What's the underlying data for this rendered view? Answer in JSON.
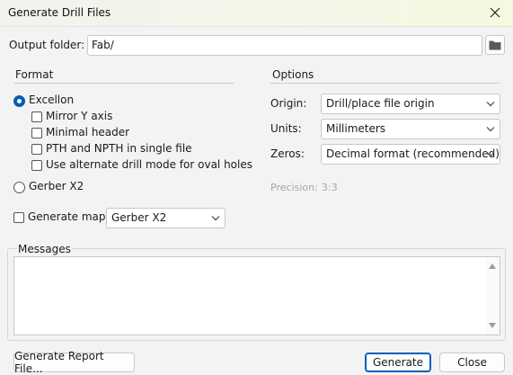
{
  "window": {
    "title": "Generate Drill Files"
  },
  "output": {
    "label": "Output folder:",
    "value": "Fab/"
  },
  "format": {
    "heading": "Format",
    "excellon_label": "Excellon",
    "excellon_selected": true,
    "options": [
      {
        "label": "Mirror Y axis",
        "checked": false
      },
      {
        "label": "Minimal header",
        "checked": false
      },
      {
        "label": "PTH and NPTH in single file",
        "checked": false
      },
      {
        "label": "Use alternate drill mode for oval holes",
        "checked": false
      }
    ],
    "gerber_label": "Gerber X2",
    "gerber_selected": false
  },
  "map": {
    "label": "Generate map:",
    "checked": false,
    "value": "Gerber X2"
  },
  "options": {
    "heading": "Options",
    "origin_label": "Origin:",
    "origin_value": "Drill/place file origin",
    "units_label": "Units:",
    "units_value": "Millimeters",
    "zeros_label": "Zeros:",
    "zeros_value": "Decimal format (recommended)",
    "precision_label": "Precision:",
    "precision_value": "3:3"
  },
  "messages": {
    "heading": "Messages"
  },
  "buttons": {
    "report": "Generate Report File...",
    "generate": "Generate",
    "close": "Close"
  }
}
